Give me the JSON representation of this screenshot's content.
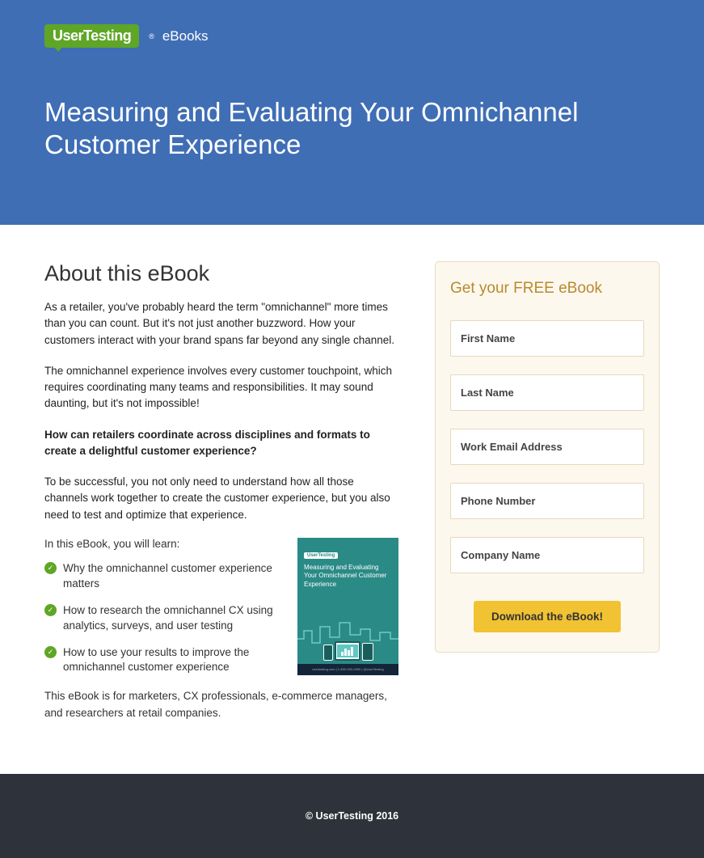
{
  "header": {
    "logo_text": "UserTesting",
    "logo_suffix": "eBooks",
    "title": "Measuring and Evaluating Your Omnichannel Customer Experience"
  },
  "about": {
    "heading": "About this eBook",
    "p1": "As a retailer, you've probably heard the term \"omnichannel\" more times than you can count. But it's not just another buzzword. How your customers interact with your brand spans far beyond any single channel.",
    "p2": "The omnichannel experience involves every customer touchpoint, which requires coordinating many teams and responsibilities. It may sound daunting, but it's not impossible!",
    "p3": "How can retailers coordinate across disciplines and formats to create a delightful customer experience?",
    "p4": "To be successful, you not only need to understand how all those channels work together to create the customer experience, but you also need to test and optimize that experience.",
    "intro": "In this eBook, you will learn:",
    "bullets": [
      "Why the omnichannel customer experience matters",
      "How to research the omnichannel CX using analytics, surveys, and user testing",
      "How to use your results to improve the omnichannel customer experience"
    ],
    "closing": "This eBook is for marketers, CX professionals, e-commerce managers, and researchers at retail companies."
  },
  "thumb": {
    "logo": "UserTesting",
    "title": "Measuring and Evaluating Your Omnichannel Customer Experience",
    "footer": "usertesting.com | 1-800-000-0000 | @UserTesting"
  },
  "form": {
    "title": "Get your FREE eBook",
    "first_name": "First Name",
    "last_name": "Last Name",
    "email": "Work Email Address",
    "phone": "Phone Number",
    "company": "Company Name",
    "submit": "Download the eBook!"
  },
  "footer": {
    "copyright": "© UserTesting 2016"
  }
}
